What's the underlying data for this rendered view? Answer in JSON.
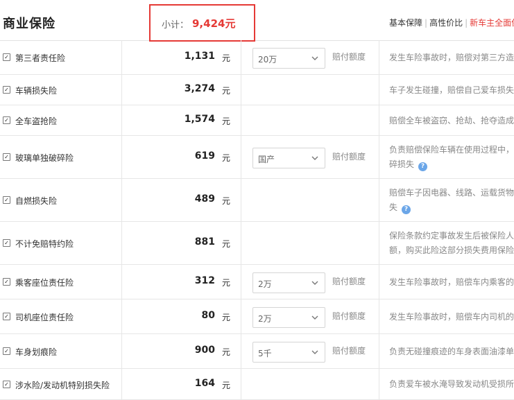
{
  "header": {
    "title": "商业保险",
    "subtotal_label": "小计：",
    "subtotal_value": "9,424元",
    "plans": [
      "基本保障",
      "高性价比",
      "新车主全面保"
    ]
  },
  "currency_unit": "元",
  "limit_label": "赔付额度",
  "rows": [
    {
      "name": "第三者责任险",
      "price": "1,131",
      "select": "20万",
      "checked": true,
      "desc_lines": [
        "发生车险事故时，赔偿对第三方造成的损失"
      ],
      "help": false
    },
    {
      "name": "车辆损失险",
      "price": "3,274",
      "select": null,
      "checked": true,
      "desc_lines": [
        "车子发生碰撞，赔偿自己爱车损失"
      ],
      "help": false
    },
    {
      "name": "全车盗抢险",
      "price": "1,574",
      "select": null,
      "checked": true,
      "desc_lines": [
        "赔偿全车被盗窃、抢劫、抢夺造成的损失"
      ],
      "help": false
    },
    {
      "name": "玻璃单独破碎险",
      "price": "619",
      "select": "国产",
      "checked": true,
      "desc_lines": [
        "负责赔偿保险车辆在使用过程中，",
        "碎损失"
      ],
      "help": true
    },
    {
      "name": "自燃损失险",
      "price": "489",
      "select": null,
      "checked": true,
      "desc_lines": [
        "赔偿车子因电器、线路、运载货物",
        "失"
      ],
      "help": true
    },
    {
      "name": "不计免赔特约险",
      "price": "881",
      "select": null,
      "checked": true,
      "desc_lines": [
        "保险条款约定事故发生后被保险人",
        "额，购买此险这部分损失费用保险"
      ],
      "help": false
    },
    {
      "name": "乘客座位责任险",
      "price": "312",
      "select": "2万",
      "checked": true,
      "desc_lines": [
        "发生车险事故时，赔偿车内乘客的"
      ],
      "help": false
    },
    {
      "name": "司机座位责任险",
      "price": "80",
      "select": "2万",
      "checked": true,
      "desc_lines": [
        "发生车险事故时，赔偿车内司机的"
      ],
      "help": false
    },
    {
      "name": "车身划痕险",
      "price": "900",
      "select": "5千",
      "checked": true,
      "desc_lines": [
        "负责无碰撞痕迹的车身表面油漆单"
      ],
      "help": false
    },
    {
      "name": "涉水险/发动机特别损失险",
      "price": "164",
      "select": null,
      "checked": true,
      "desc_lines": [
        "负责爱车被水淹导致发动机受损所"
      ],
      "help": false
    }
  ],
  "colors": {
    "accent_red": "#e53935",
    "help_blue": "#6ba6e8",
    "border": "#e6e6e6"
  }
}
